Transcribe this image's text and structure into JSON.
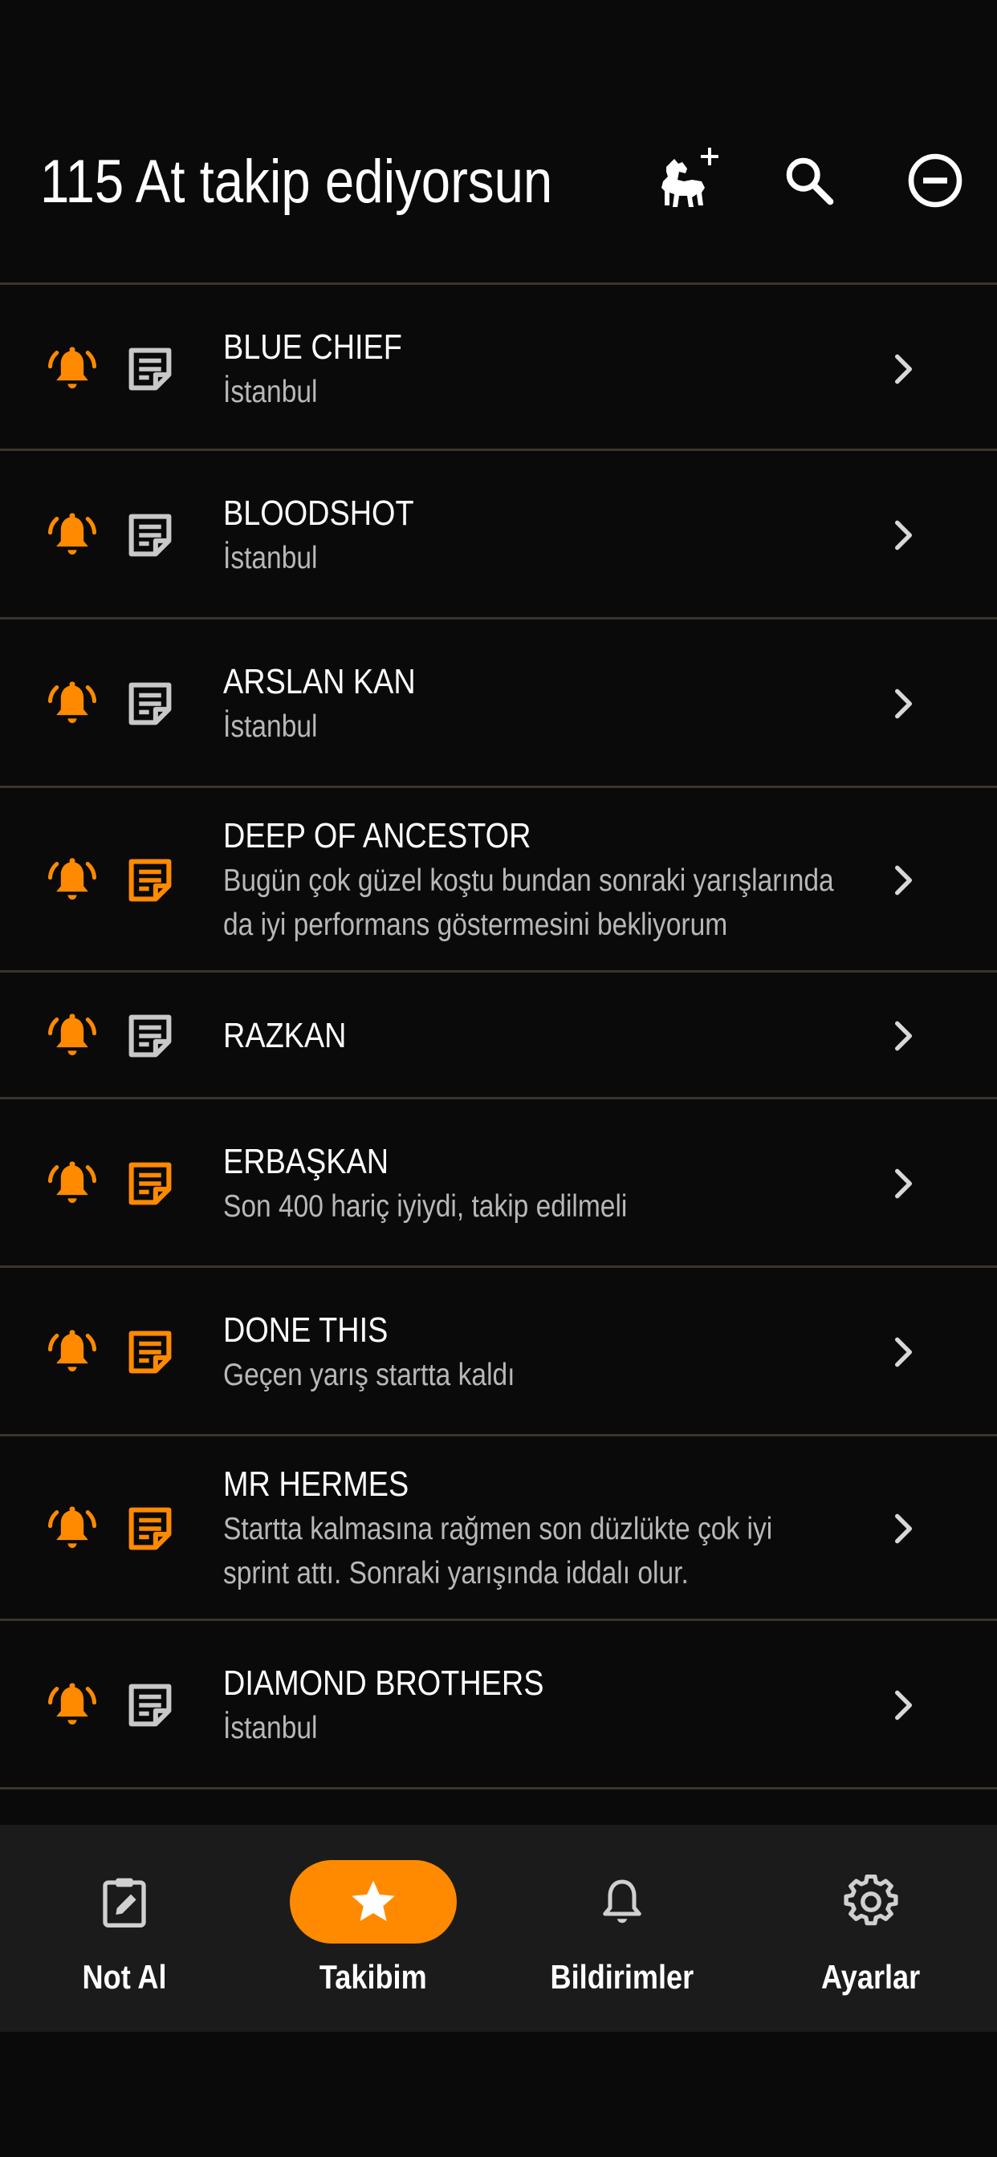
{
  "header": {
    "title": "115 At takip ediyorsun",
    "icons": [
      "horse-add-icon",
      "search-icon",
      "minus-circle-icon"
    ]
  },
  "colors": {
    "background": "#0a0a0a",
    "accent": "#ff8a00",
    "divider": "#3b342c",
    "note_inactive": "#c8c8c8",
    "secondary_text": "#b8b8b8",
    "nav_background": "#1b1b1b"
  },
  "horses": [
    {
      "name": "BLUE CHIEF",
      "sub": [
        "İstanbul"
      ],
      "has_note": false
    },
    {
      "name": "BLOODSHOT",
      "sub": [
        "İstanbul"
      ],
      "has_note": false
    },
    {
      "name": "ARSLAN KAN",
      "sub": [
        "İstanbul"
      ],
      "has_note": false
    },
    {
      "name": "DEEP OF ANCESTOR",
      "sub": [
        "Bugün çok güzel koştu bundan sonraki yarışlarında",
        "da iyi performans göstermesini bekliyorum"
      ],
      "has_note": true
    },
    {
      "name": "RAZKAN",
      "sub": [],
      "has_note": false
    },
    {
      "name": "ERBAŞKAN",
      "sub": [
        "Son 400 hariç iyiydi, takip edilmeli"
      ],
      "has_note": true
    },
    {
      "name": "DONE THIS",
      "sub": [
        "Geçen yarış startta kaldı"
      ],
      "has_note": true
    },
    {
      "name": "MR HERMES",
      "sub": [
        "Startta kalmasına rağmen son düzlükte çok iyi",
        "sprint attı. Sonraki yarışında iddalı olur."
      ],
      "has_note": true
    },
    {
      "name": "DIAMOND BROTHERS",
      "sub": [
        "İstanbul"
      ],
      "has_note": false
    }
  ],
  "nav": [
    {
      "label": "Not Al",
      "icon": "edit-note-icon",
      "active": false
    },
    {
      "label": "Takibim",
      "icon": "star-icon",
      "active": true
    },
    {
      "label": "Bildirimler",
      "icon": "bell-icon",
      "active": false
    },
    {
      "label": "Ayarlar",
      "icon": "gear-icon",
      "active": false
    }
  ]
}
